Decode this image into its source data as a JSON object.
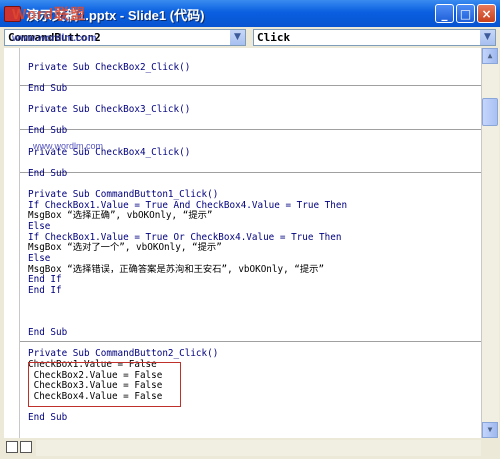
{
  "window": {
    "title": "演示文稿1.pptx - Slide1 (代码)",
    "watermark_top": "Word联盟",
    "watermark_url": "www.wordlm.com",
    "minimize_glyph": "_",
    "maximize_glyph": "□",
    "close_glyph": "×"
  },
  "combos": {
    "object": "CommandButton2",
    "procedure": "Click",
    "arrow_glyph": "▼"
  },
  "code": {
    "lines": [
      "Private Sub CheckBox2_Click()",
      "End Sub",
      "Private Sub CheckBox3_Click()",
      "End Sub",
      "Private Sub CheckBox4_Click()",
      "End Sub",
      "Private Sub CommandButton1_Click()",
      "If CheckBox1.Value = True And CheckBox4.Value = True Then",
      "MsgBox “选择正确”, vbOKOnly, “提示”",
      "Else",
      "If CheckBox1.Value = True Or CheckBox4.Value = True Then",
      "MsgBox “选对了一个”, vbOKOnly, “提示”",
      "Else",
      "MsgBox “选择错误，正确答案是苏洵和王安石”, vbOKOnly, “提示”",
      "End If",
      "End If",
      "End Sub",
      "Private Sub CommandButton2_Click()",
      "CheckBox1.Value = False",
      " CheckBox2.Value = False",
      " CheckBox3.Value = False",
      " CheckBox4.Value = False",
      "End Sub"
    ],
    "watermark_url": "www.wordlm.com"
  },
  "scrollbar": {
    "up_glyph": "▲",
    "down_glyph": "▼"
  },
  "colors": {
    "titlebar": "#0a5fe0",
    "highlight_border": "#c0302a",
    "editor_bg": "#ffffff"
  }
}
